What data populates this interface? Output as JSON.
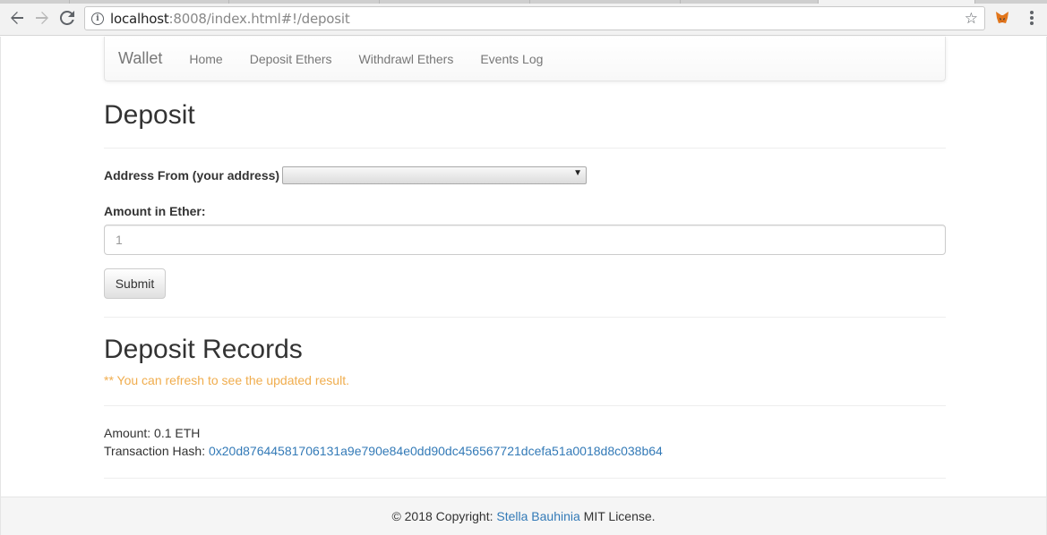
{
  "browser": {
    "url_host": "localhost",
    "url_rest": ":8008/index.html#!/deposit",
    "back_icon": "arrow-left-icon",
    "forward_icon": "arrow-right-icon",
    "reload_icon": "reload-icon",
    "info_icon": "info-icon",
    "info_glyph": "i",
    "star_icon": "star-icon",
    "extension_icon": "metamask-fox-icon",
    "menu_icon": "kebab-menu-icon"
  },
  "navbar": {
    "brand": "Wallet",
    "links": [
      "Home",
      "Deposit Ethers",
      "Withdrawl Ethers",
      "Events Log"
    ]
  },
  "deposit": {
    "title": "Deposit",
    "address_label": "Address From (your address)",
    "address_selected": "",
    "amount_label": "Amount in Ether:",
    "amount_placeholder": "1",
    "submit_label": "Submit"
  },
  "records": {
    "title": "Deposit Records",
    "note": "** You can refresh to see the updated result.",
    "amount_text": "Amount: 0.1 ETH",
    "tx_label": "Transaction Hash:",
    "tx_hash": "0x20d87644581706131a9e790e84e0dd90dc456567721dcefa51a0018d8c038b64"
  },
  "footer": {
    "prefix": "© 2018 Copyright:",
    "author": "Stella Bauhinia",
    "suffix": "MIT License."
  },
  "colors": {
    "link": "#337ab7",
    "note": "#f0ad4e"
  }
}
